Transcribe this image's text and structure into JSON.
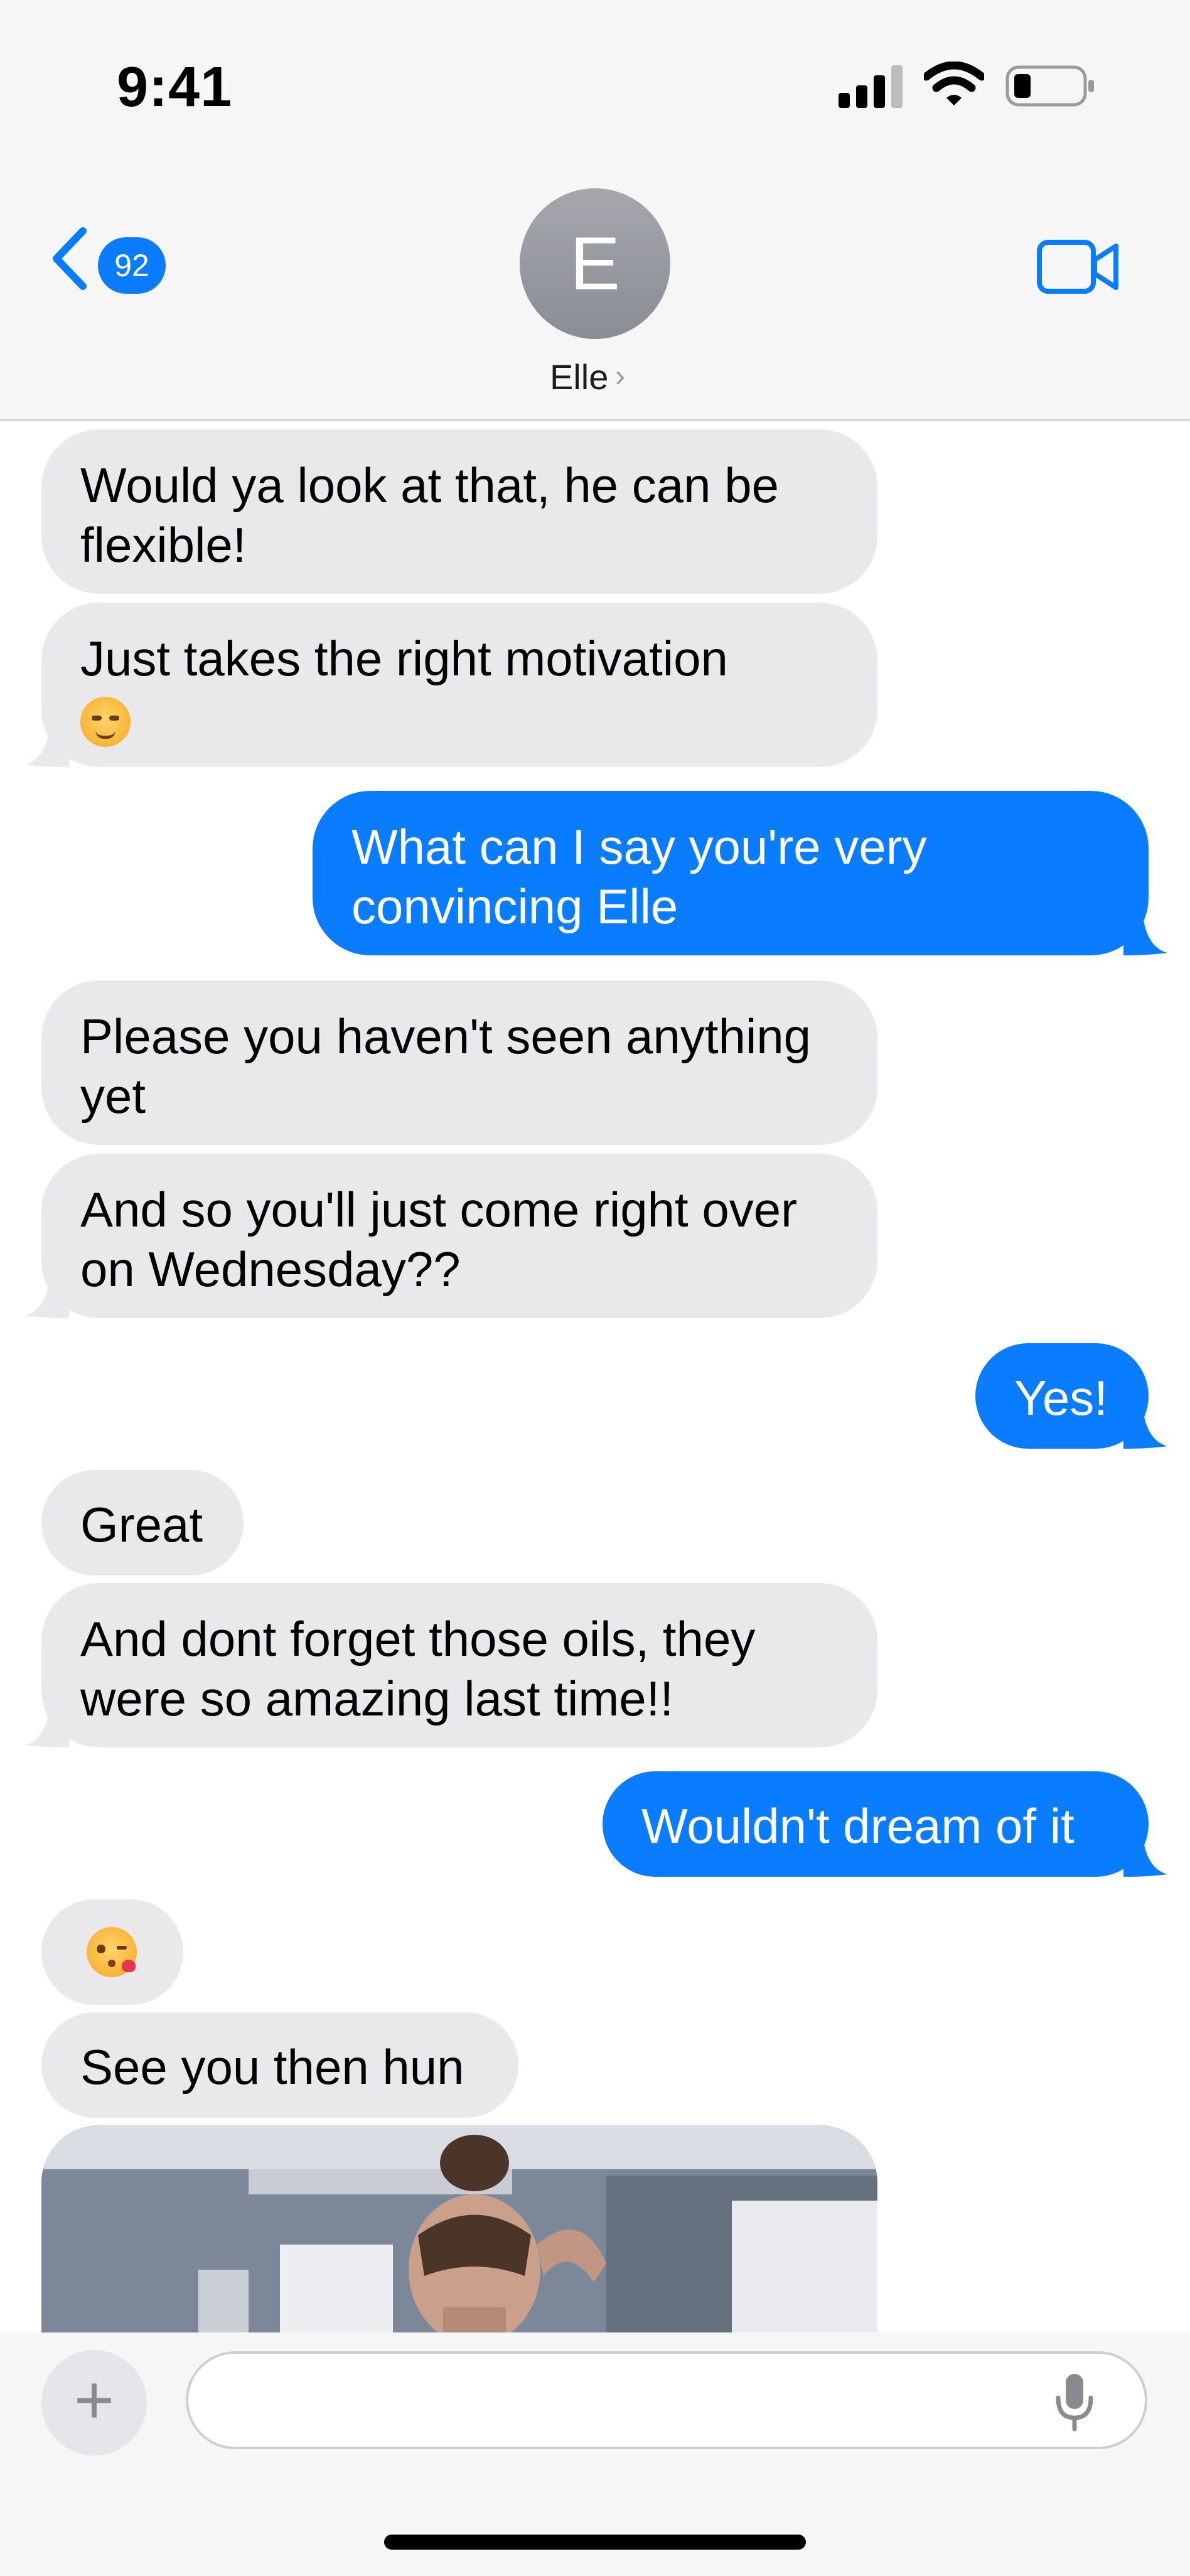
{
  "status_bar": {
    "time": "9:41"
  },
  "header": {
    "back_count": "92",
    "avatar_initial": "E",
    "contact_name": "Elle"
  },
  "messages": [
    {
      "from": "them",
      "text": "Would ya look at that, he can be flexible!"
    },
    {
      "from": "them",
      "text": "Just takes the right motivation",
      "emoji": "smirking-face-emoji"
    },
    {
      "from": "me",
      "text": "What can I say you're very convincing Elle"
    },
    {
      "from": "them",
      "text": "Please you haven't seen anything yet"
    },
    {
      "from": "them",
      "text": "And so you'll just come right over on Wednesday??"
    },
    {
      "from": "me",
      "text": "Yes!"
    },
    {
      "from": "them",
      "text": "Great"
    },
    {
      "from": "them",
      "text": "And dont forget those oils, they were so amazing last time!!"
    },
    {
      "from": "me",
      "text": "Wouldn't dream of it"
    },
    {
      "from": "them",
      "emoji": "face-blowing-kiss-emoji"
    },
    {
      "from": "them",
      "text": "See you then hun"
    },
    {
      "from": "them",
      "attachment": "photo"
    }
  ],
  "composer": {
    "placeholder": ""
  },
  "colors": {
    "sent_bubble": "#0a7cff",
    "received_bubble": "#e9e9eb",
    "accent": "#0a7cff"
  }
}
